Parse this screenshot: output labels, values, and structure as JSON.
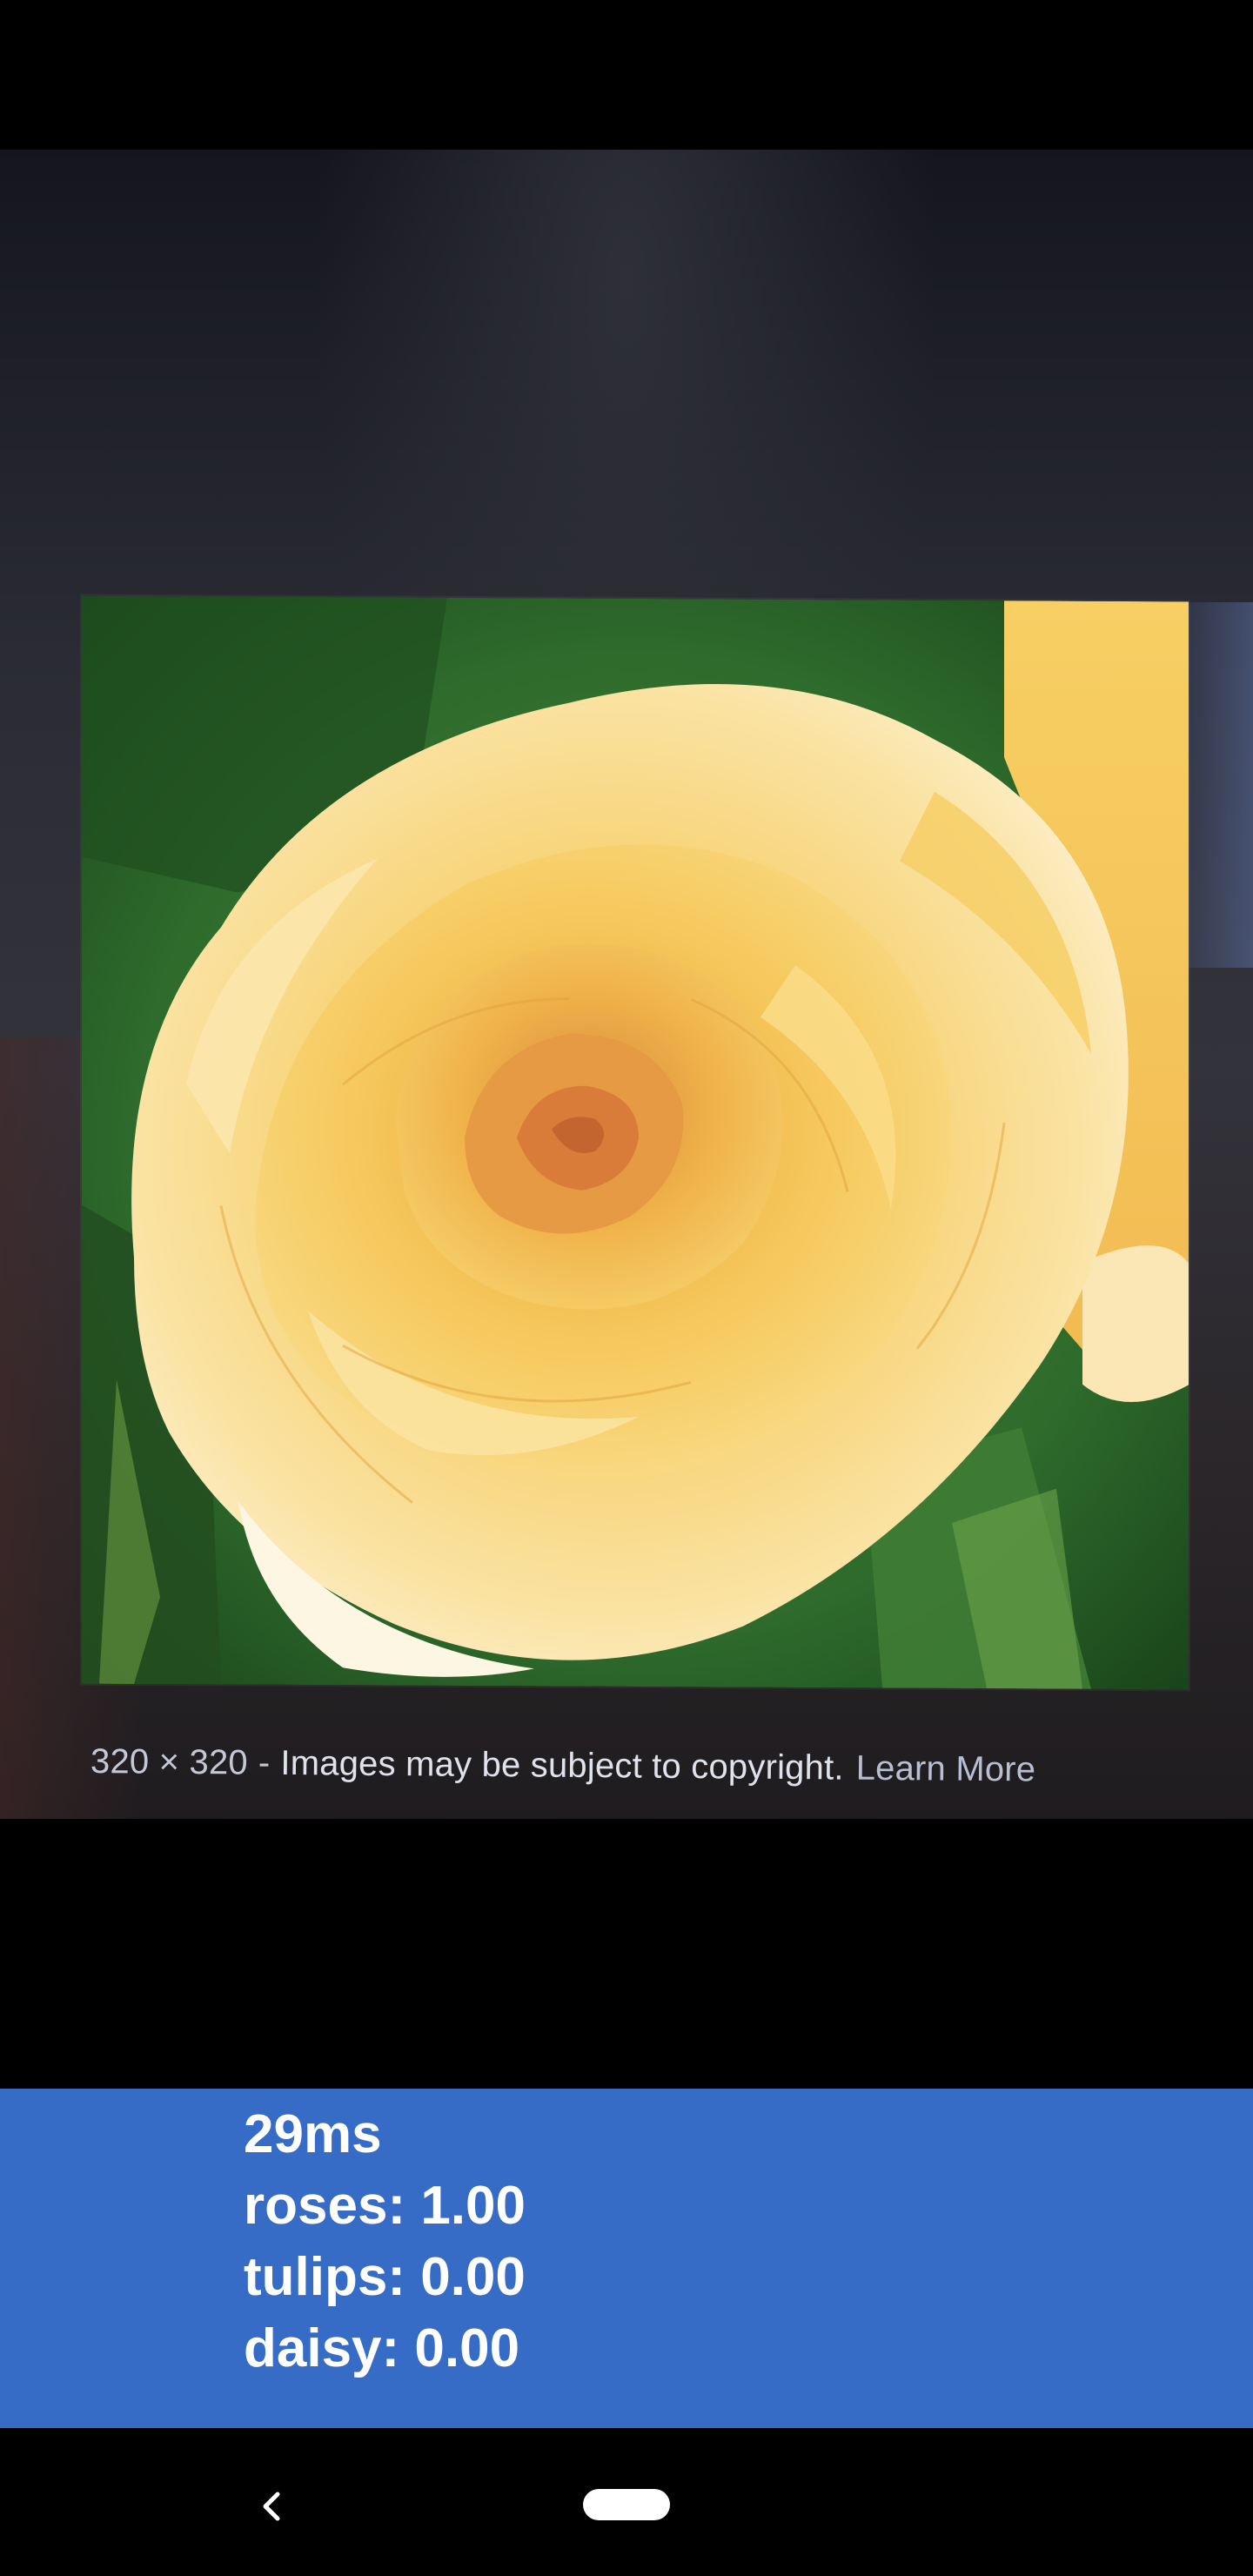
{
  "caption": {
    "image_size": "320 × 320",
    "separator": "-",
    "notice": "Images may be subject to copyright.",
    "learn_more": "Learn More"
  },
  "results": {
    "inference_time": "29ms",
    "lines": [
      "roses: 1.00",
      "tulips: 0.00",
      "daisy: 0.00"
    ]
  },
  "colors": {
    "results_background": "#366cc6",
    "results_text": "#ffffff",
    "petal": "#f6cf6a",
    "leaves": "#2e6b2c"
  },
  "icons": {
    "back": "chevron-left-icon",
    "home": "home-pill-icon"
  }
}
